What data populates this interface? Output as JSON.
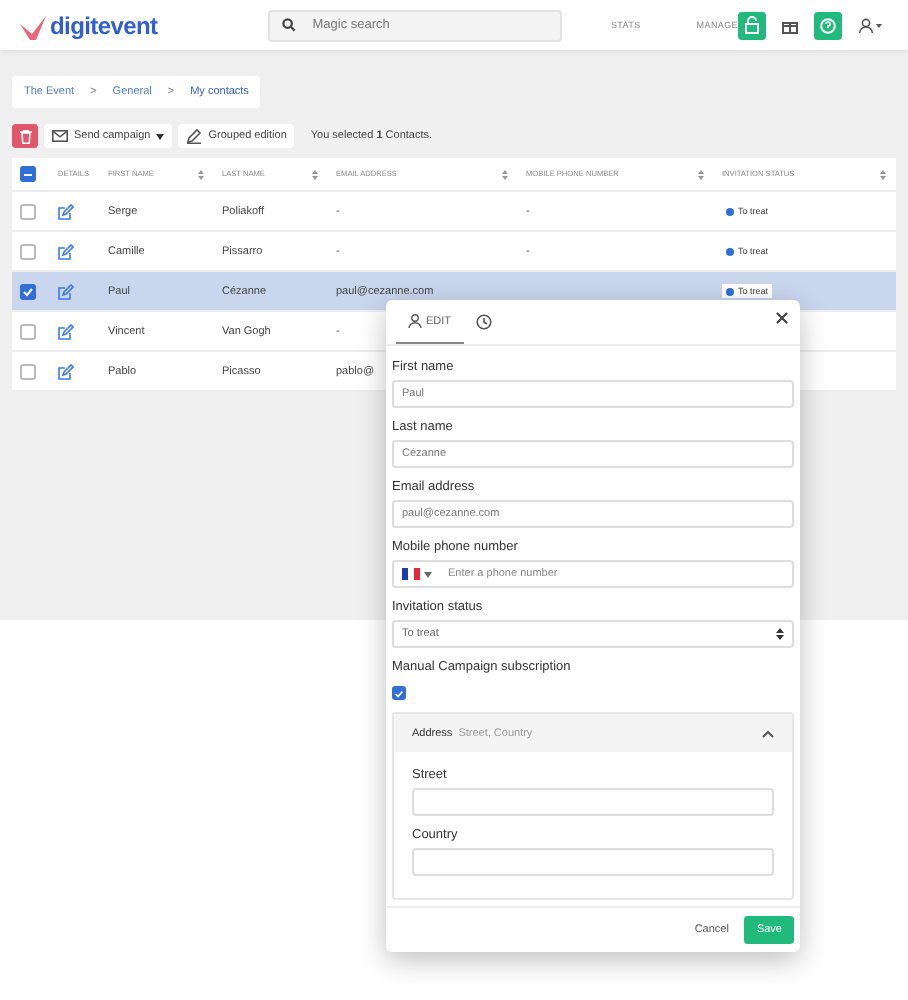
{
  "header": {
    "logo": "digitevent",
    "search": {
      "placeholder": "Magic search"
    },
    "nav": [
      "STATS",
      "MANAGE"
    ]
  },
  "breadcrumb": [
    "The Event",
    "General",
    "My contacts"
  ],
  "breadcrumb_separator": ">",
  "toolbar": {
    "send_campaign": "Send campaign",
    "grouped_edition": "Grouped edition",
    "selection_before": "You selected ",
    "selection_count": "1",
    "selection_after": " Contacts."
  },
  "table": {
    "select_all_partial": true,
    "columns": [
      {
        "label": "DETAILS",
        "sortable": false
      },
      {
        "label": "FIRST NAME",
        "sortable": true
      },
      {
        "label": "LAST NAME",
        "sortable": true
      },
      {
        "label": "EMAIL ADDRESS",
        "sortable": true
      },
      {
        "label": "MOBILE PHONE NUMBER",
        "sortable": true
      },
      {
        "label": "INVITATION STATUS",
        "sortable": true
      }
    ],
    "rows": [
      {
        "selected": false,
        "first_name": "Serge",
        "last_name": "Poliakoff",
        "email": "-",
        "phone": "-",
        "status": "To treat"
      },
      {
        "selected": false,
        "first_name": "Camille",
        "last_name": "Pissarro",
        "email": "-",
        "phone": "-",
        "status": "To treat"
      },
      {
        "selected": true,
        "first_name": "Paul",
        "last_name": "Cézanne",
        "email": "paul@cezanne.com",
        "status": "To treat"
      },
      {
        "selected": false,
        "first_name": "Vincent",
        "last_name": "Van Gogh",
        "email": "-"
      },
      {
        "selected": false,
        "first_name": "Pablo",
        "last_name": "Picasso",
        "email": "pablo@"
      }
    ]
  },
  "modal": {
    "tabs": [
      {
        "kind": "edit",
        "label": "EDIT",
        "selected": true
      },
      {
        "kind": "history",
        "selected": false
      }
    ],
    "fields": [
      {
        "kind": "text",
        "label": "First name",
        "value": "Paul"
      },
      {
        "kind": "text",
        "label": "Last name",
        "value": "Cézanne"
      },
      {
        "kind": "text",
        "label": "Email address",
        "value": "paul@cezanne.com"
      },
      {
        "kind": "phone",
        "label": "Mobile phone number",
        "placeholder": "Enter a phone number"
      },
      {
        "kind": "select",
        "label": "Invitation status",
        "value": "To treat"
      },
      {
        "kind": "checkbox",
        "label": "Manual Campaign subscription",
        "checked": true
      }
    ],
    "address": {
      "title": "Address",
      "summary": "Street, Country",
      "expanded": true,
      "fields": [
        {
          "label": "Street"
        },
        {
          "label": "Country"
        }
      ]
    },
    "buttons": {
      "cancel": "Cancel",
      "save": "Save"
    }
  }
}
